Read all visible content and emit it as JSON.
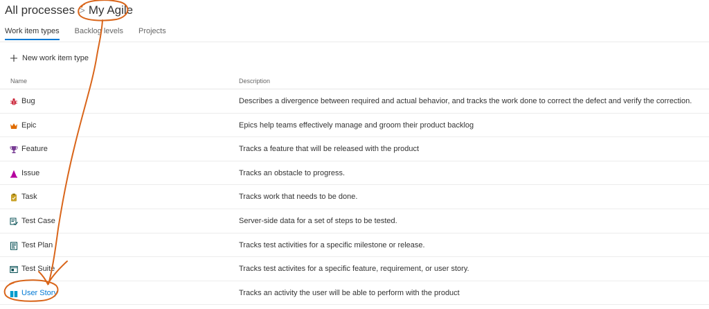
{
  "breadcrumb": {
    "root": "All processes",
    "separator": ">",
    "current": "My Agile"
  },
  "tabs": [
    {
      "label": "Work item types",
      "active": true
    },
    {
      "label": "Backlog levels",
      "active": false
    },
    {
      "label": "Projects",
      "active": false
    }
  ],
  "toolbar": {
    "new_label": "New work item type",
    "new_icon": "plus-icon"
  },
  "table": {
    "columns": {
      "name": "Name",
      "description": "Description"
    },
    "rows": [
      {
        "name": "Bug",
        "icon": "bug-icon",
        "color": "#cc293d",
        "description": "Describes a divergence between required and actual behavior, and tracks the work done to correct the defect and verify the correction."
      },
      {
        "name": "Epic",
        "icon": "crown-icon",
        "color": "#e06c00",
        "description": "Epics help teams effectively manage and groom their product backlog"
      },
      {
        "name": "Feature",
        "icon": "trophy-icon",
        "color": "#773b93",
        "description": "Tracks a feature that will be released with the product"
      },
      {
        "name": "Issue",
        "icon": "cone-icon",
        "color": "#b4009e",
        "description": "Tracks an obstacle to progress."
      },
      {
        "name": "Task",
        "icon": "clipboard-icon",
        "color": "#c9a227",
        "description": "Tracks work that needs to be done."
      },
      {
        "name": "Test Case",
        "icon": "test-case-icon",
        "color": "#004b50",
        "description": "Server-side data for a set of steps to be tested."
      },
      {
        "name": "Test Plan",
        "icon": "test-plan-icon",
        "color": "#004b50",
        "description": "Tracks test activities for a specific milestone or release."
      },
      {
        "name": "Test Suite",
        "icon": "test-suite-icon",
        "color": "#004b50",
        "description": "Tracks test activites for a specific feature, requirement, or user story."
      },
      {
        "name": "User Story",
        "icon": "book-icon",
        "color": "#009ccc",
        "description": "Tracks an activity the user will be able to perform with the product"
      }
    ]
  },
  "colors": {
    "accent": "#0078d4",
    "annotation": "#d9651a"
  }
}
